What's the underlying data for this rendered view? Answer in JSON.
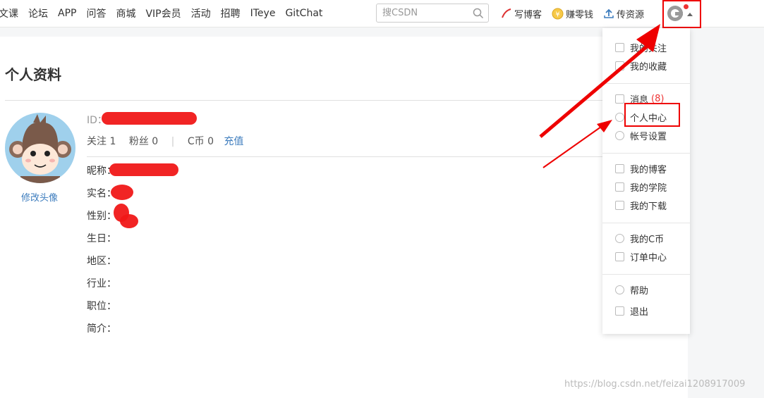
{
  "nav": {
    "items": [
      "文课",
      "论坛",
      "APP",
      "问答",
      "商城",
      "VIP会员",
      "活动",
      "招聘",
      "ITeye",
      "GitChat"
    ]
  },
  "search": {
    "placeholder": "搜CSDN"
  },
  "toolbar": {
    "write_blog": "写博客",
    "earn": "赚零钱",
    "upload": "传资源"
  },
  "profile": {
    "page_title": "个人资料",
    "id_label": "ID：",
    "follow_label": "关注",
    "follow_count": "1",
    "fans_label": "粉丝",
    "fans_count": "0",
    "coin_label": "C币",
    "coin_count": "0",
    "recharge": "充值",
    "edit_avatar": "修改头像",
    "fields": {
      "nickname": "昵称：",
      "realname": "实名：",
      "gender": "性别：",
      "birthday": "生日：",
      "region": "地区：",
      "industry": "行业：",
      "position": "职位：",
      "bio": "简介："
    }
  },
  "dropdown": {
    "my_follow": "我的关注",
    "my_favorites": "我的收藏",
    "messages": "消息",
    "messages_count": "(8)",
    "personal_center": "个人中心",
    "account_settings": "帐号设置",
    "my_blog": "我的博客",
    "my_academy": "我的学院",
    "my_downloads": "我的下载",
    "my_coins": "我的C币",
    "orders": "订单中心",
    "help": "帮助",
    "logout": "退出"
  },
  "watermark": "https://blog.csdn.net/feizai1208917009",
  "colors": {
    "annotation_red": "#e00000",
    "link_blue": "#3c7cbd"
  }
}
